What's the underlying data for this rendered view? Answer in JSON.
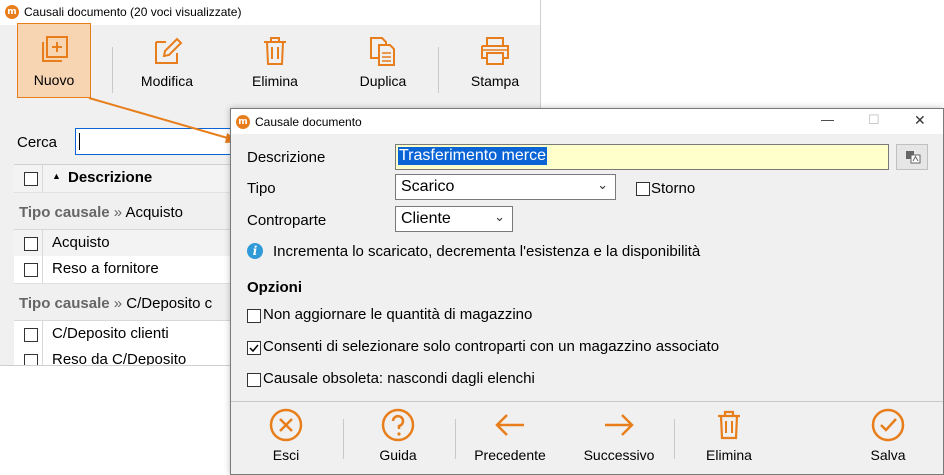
{
  "bg_window": {
    "title": "Causali documento (20 voci visualizzate)",
    "app_icon_letter": "m",
    "toolbar": [
      {
        "name": "nuovo",
        "label": "Nuovo"
      },
      {
        "name": "modifica",
        "label": "Modifica"
      },
      {
        "name": "elimina",
        "label": "Elimina"
      },
      {
        "name": "duplica",
        "label": "Duplica"
      },
      {
        "name": "stampa",
        "label": "Stampa"
      }
    ],
    "search_label": "Cerca",
    "column_header": "Descrizione",
    "sort_indicator": "▲",
    "groups": [
      {
        "prefix": "Tipo causale",
        "sep": "»",
        "value": "Acquisto"
      },
      {
        "prefix": "Tipo causale",
        "sep": "»",
        "value": "C/Deposito c"
      }
    ],
    "rows": [
      "Acquisto",
      "Reso a fornitore",
      "C/Deposito clienti",
      "Reso da C/Deposito"
    ]
  },
  "dialog": {
    "title": "Causale documento",
    "app_icon_letter": "m",
    "window_controls": {
      "minimize": "—",
      "maximize": "☐",
      "close": "✕"
    },
    "descrizione_label": "Descrizione",
    "descrizione_value": "Trasferimento merce",
    "tipo_label": "Tipo",
    "tipo_value": "Scarico",
    "storno_label": "Storno",
    "controparte_label": "Controparte",
    "controparte_value": "Cliente",
    "info_text": "Incrementa lo scaricato, decrementa l'esistenza e la disponibilità",
    "opzioni_header": "Opzioni",
    "options": [
      {
        "label": "Non aggiornare le quantità di magazzino",
        "checked": false
      },
      {
        "label": "Consenti di selezionare solo controparti con un magazzino associato",
        "checked": true
      },
      {
        "label": "Causale obsoleta: nascondi dagli elenchi",
        "checked": false
      }
    ],
    "buttons": [
      {
        "name": "esci",
        "label": "Esci"
      },
      {
        "name": "guida",
        "label": "Guida"
      },
      {
        "name": "precedente",
        "label": "Precedente"
      },
      {
        "name": "successivo",
        "label": "Successivo"
      },
      {
        "name": "elimina",
        "label": "Elimina"
      },
      {
        "name": "salva",
        "label": "Salva"
      }
    ]
  },
  "colors": {
    "accent": "#e87e1b",
    "selection": "#0a64d6",
    "field_highlight": "#ffffcc",
    "info": "#2f9ad8"
  }
}
